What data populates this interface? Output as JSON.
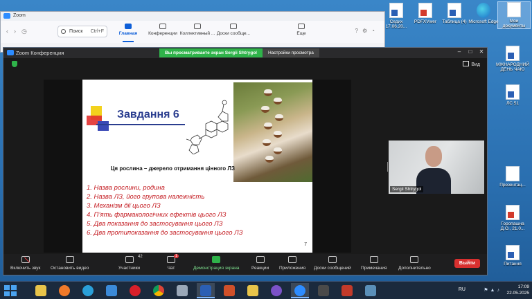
{
  "desktop": {
    "icons": [
      {
        "label": "Седих 17.06.20...",
        "kind": "doc"
      },
      {
        "label": "PDFXVwer",
        "kind": "pdf"
      },
      {
        "label": "Таблица (4)",
        "kind": "doc"
      },
      {
        "label": "Microsoft Edge",
        "kind": "edge"
      },
      {
        "label": "Мои документы",
        "kind": "folder"
      },
      {
        "label": "МЖНАРОДНИЙ ДЕНЬ ЧАЮ",
        "kind": "doc"
      },
      {
        "label": "ЛС 51",
        "kind": "doc"
      },
      {
        "label": "Презентац...",
        "kind": "doc"
      },
      {
        "label": "Горопашна Д.О., 21.0...",
        "kind": "pdf"
      },
      {
        "label": "Питання",
        "kind": "doc"
      }
    ]
  },
  "zoom_home": {
    "title": "Zoom",
    "search_label": "Поиск",
    "search_shortcut": "Ctrl+F",
    "tabs": [
      {
        "label": "Главная",
        "active": true
      },
      {
        "label": "Конференции",
        "active": false
      },
      {
        "label": "Коллективный ...",
        "active": false
      },
      {
        "label": "Доски сообще...",
        "active": false
      },
      {
        "label": "Еще",
        "active": false
      }
    ]
  },
  "meeting": {
    "title": "Zoom Конференция",
    "share_banner": "Вы просматриваете экран Sergii Shtrygol",
    "view_options": "Настройки просмотра",
    "view_button": "Вид",
    "participant": {
      "name": "Sergii Shtrygol"
    },
    "slide": {
      "title": "Завдання 6",
      "subtitle": "Ця рослина – джерело отримання цінного ЛЗ",
      "tasks": [
        "1. Назва рослини, родина",
        "2. Назва ЛЗ, його групова належність",
        "3. Механізм дії цього ЛЗ",
        "4. П’ять фармакологічних ефектів цього ЛЗ",
        "5. Два показання до застосування цього ЛЗ",
        "6. Два протипоказання до застосування цього ЛЗ"
      ],
      "page_number": "7"
    },
    "toolbar": {
      "mute": "Включить звук",
      "video": "Остановить видео",
      "participants": "Участники",
      "participants_count": "42",
      "chat": "Чат",
      "chat_badge": "1",
      "share": "Демонстрация экрана",
      "reactions": "Реакции",
      "apps": "Приложения",
      "whiteboards": "Доски сообщений",
      "notes": "Примечания",
      "more": "Дополнительно",
      "leave": "Выйти"
    }
  },
  "taskbar": {
    "language": "RU",
    "time": "17:09",
    "date": "22.05.2025"
  },
  "colors": {
    "slide_title": "#2a3d8f",
    "task_text": "#c41d23",
    "share_green": "#2fb34a",
    "leave_red": "#d8302f",
    "zoom_blue": "#2d8cff"
  }
}
